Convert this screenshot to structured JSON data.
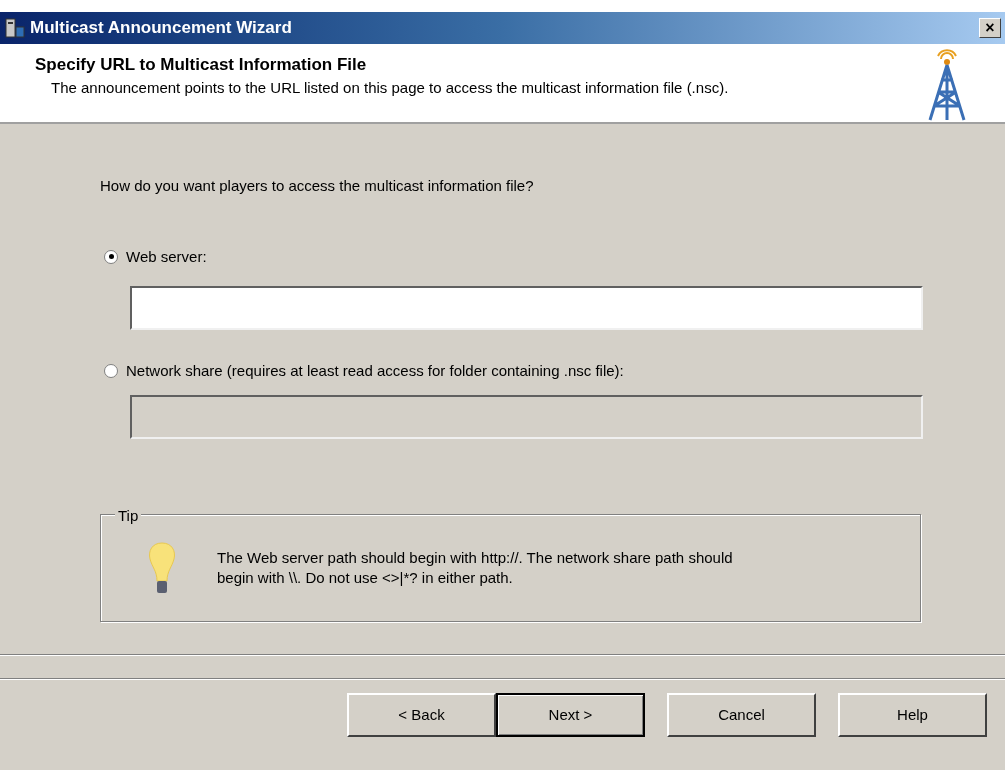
{
  "window": {
    "title": "Multicast Announcement Wizard",
    "close": "×"
  },
  "header": {
    "title": "Specify URL to Multicast Information File",
    "description": "The announcement points to the URL listed on this page to access the multicast information file (.nsc)."
  },
  "question": "How do you want players to access the multicast information file?",
  "options": [
    {
      "label": "Web server:",
      "selected": true,
      "field": {
        "disabled": false
      }
    },
    {
      "label": "Network share (requires at least read access for folder containing .nsc file):",
      "selected": false,
      "field": {
        "disabled": true
      }
    }
  ],
  "tip": {
    "title": "Tip",
    "text": "The Web server path should begin with http://. The network share path should begin with \\\\. Do not use <>|*? in either path."
  },
  "buttons": [
    {
      "label": "< Back",
      "default": false
    },
    {
      "label": "Next >",
      "default": true
    },
    {
      "label": "Cancel",
      "default": false
    },
    {
      "label": "Help",
      "default": false
    }
  ]
}
